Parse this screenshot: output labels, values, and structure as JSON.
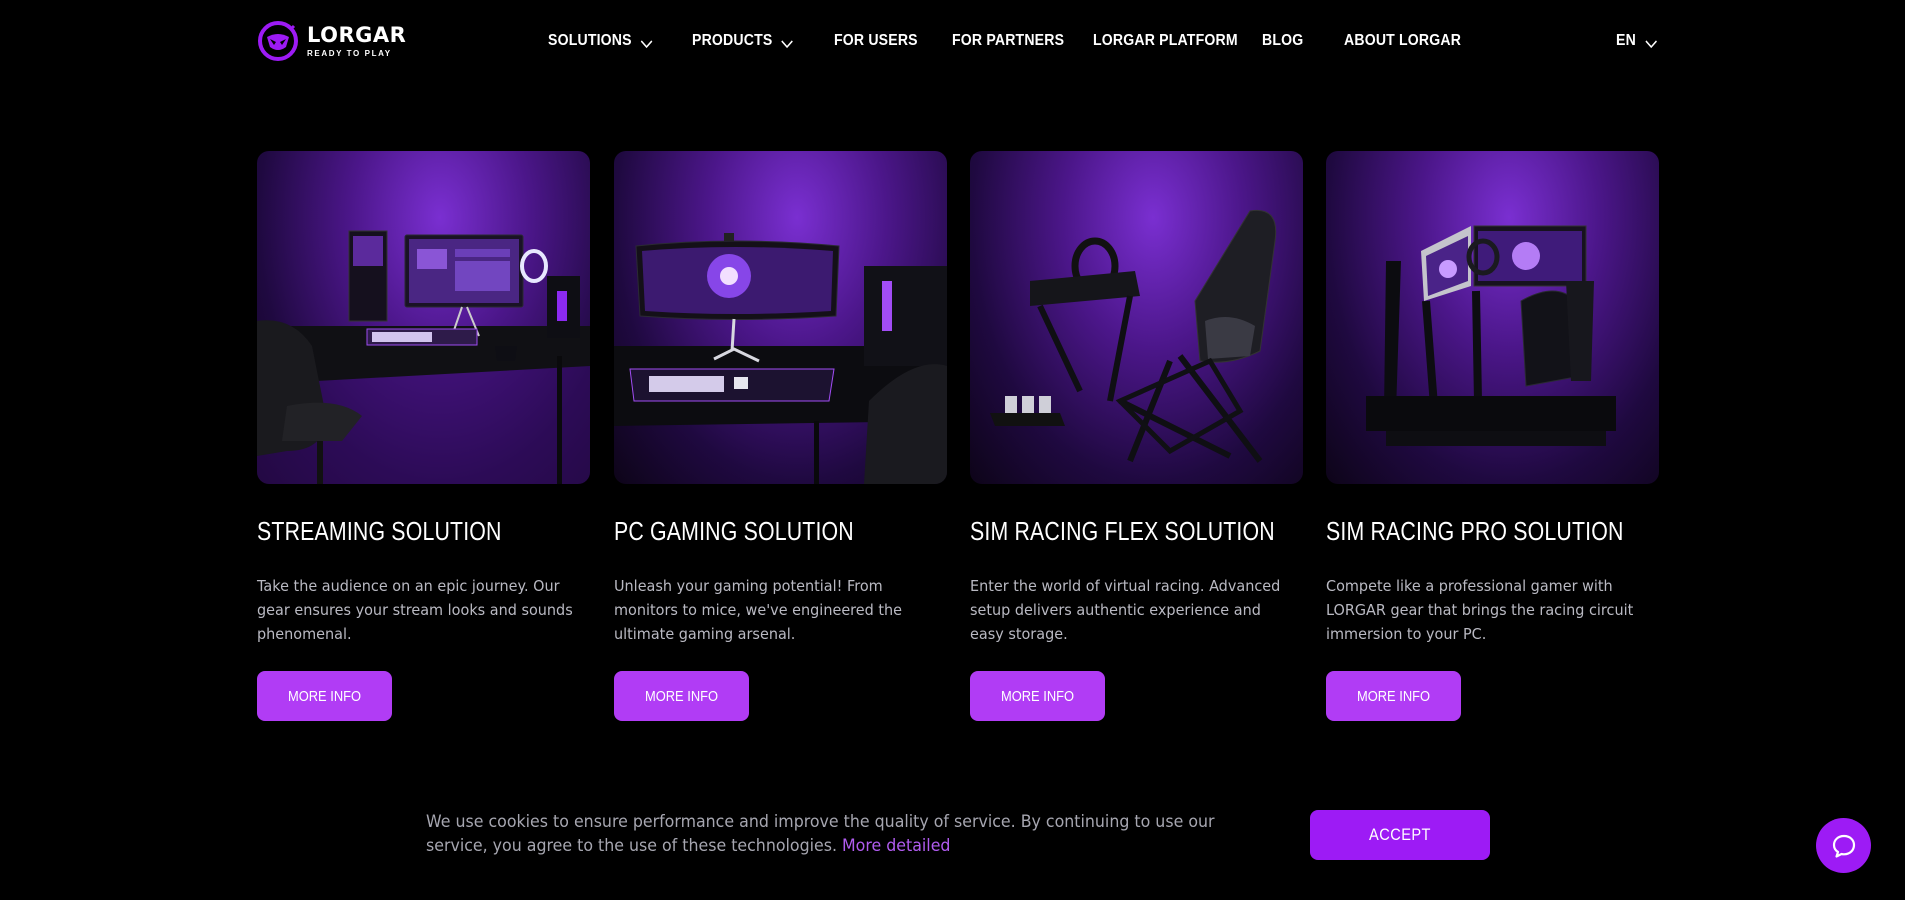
{
  "brand": {
    "name": "LORGAR",
    "tagline": "READY TO PLAY",
    "accent_color": "#b13cf5",
    "accept_color": "#9d1bf5"
  },
  "nav": {
    "items": [
      {
        "label": "SOLUTIONS",
        "has_dropdown": true
      },
      {
        "label": "PRODUCTS",
        "has_dropdown": true
      },
      {
        "label": "FOR USERS",
        "has_dropdown": false
      },
      {
        "label": "FOR PARTNERS",
        "has_dropdown": false
      },
      {
        "label": "LORGAR PLATFORM",
        "has_dropdown": false
      },
      {
        "label": "BLOG",
        "has_dropdown": false
      },
      {
        "label": "ABOUT LORGAR",
        "has_dropdown": false
      }
    ],
    "language": "EN"
  },
  "solutions": [
    {
      "title": "STREAMING SOLUTION",
      "description": "Take the audience on an epic journey. Our gear ensures your stream looks and sounds phenomenal.",
      "button": "MORE INFO",
      "image_icon": "streaming-setup-image"
    },
    {
      "title": "PC GAMING SOLUTION",
      "description": "Unleash your gaming potential! From monitors to mice, we've engineered the ultimate gaming arsenal.",
      "button": "MORE INFO",
      "image_icon": "pc-gaming-setup-image"
    },
    {
      "title": "SIM RACING FLEX SOLUTION",
      "description": "Enter the world of virtual racing. Advanced setup delivers authentic experience and easy storage.",
      "button": "MORE INFO",
      "image_icon": "sim-racing-flex-image"
    },
    {
      "title": "SIM RACING PRO SOLUTION",
      "description": "Compete like a professional gamer with LORGAR gear that brings the racing circuit immersion to your PC.",
      "button": "MORE INFO",
      "image_icon": "sim-racing-pro-image"
    }
  ],
  "cookie": {
    "text": "We use cookies to ensure performance and improve the quality of service. By continuing to use our service, you agree to the use of these technologies.",
    "link": "More detailed",
    "accept": "ACCEPT"
  },
  "chat": {
    "icon": "chat-bubble-icon"
  }
}
